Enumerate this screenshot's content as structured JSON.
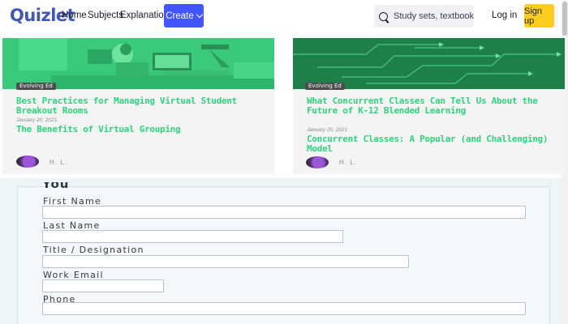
{
  "nav": {
    "logo": "Quizlet",
    "links": [
      "Home",
      "Subjects",
      "Explanations"
    ],
    "create_label": "Create",
    "search_placeholder": "Study sets, textbooks, ...",
    "login_label": "Log in",
    "signup_label": "Sign up"
  },
  "articles": [
    {
      "tag": "Evolving Ed",
      "title": "Best Practices for Managing Virtual Student Breakout Rooms",
      "date": "January 20, 2021",
      "subtitle": "The Benefits of Virtual Grouping",
      "author": "H. L."
    },
    {
      "tag": "Evolving Ed",
      "title": "What Concurrent Classes Can Tell Us About the Future of K-12 Blended Learning",
      "date": "January 20, 2021",
      "subtitle": "Concurrent Classes: A Popular (and Challenging) Model",
      "author": "H. L."
    }
  ],
  "form": {
    "legend": "You",
    "fields": [
      {
        "label": "First Name"
      },
      {
        "label": "Last Name"
      },
      {
        "label": "Title / Designation"
      },
      {
        "label": "Work Email"
      },
      {
        "label": "Phone"
      }
    ]
  },
  "colors": {
    "brand": "#4257b2",
    "create_button": "#4255ff",
    "signup_button": "#ffcd1f",
    "article_title": "#2ed17c",
    "image_tint": "#3ecf7f"
  }
}
